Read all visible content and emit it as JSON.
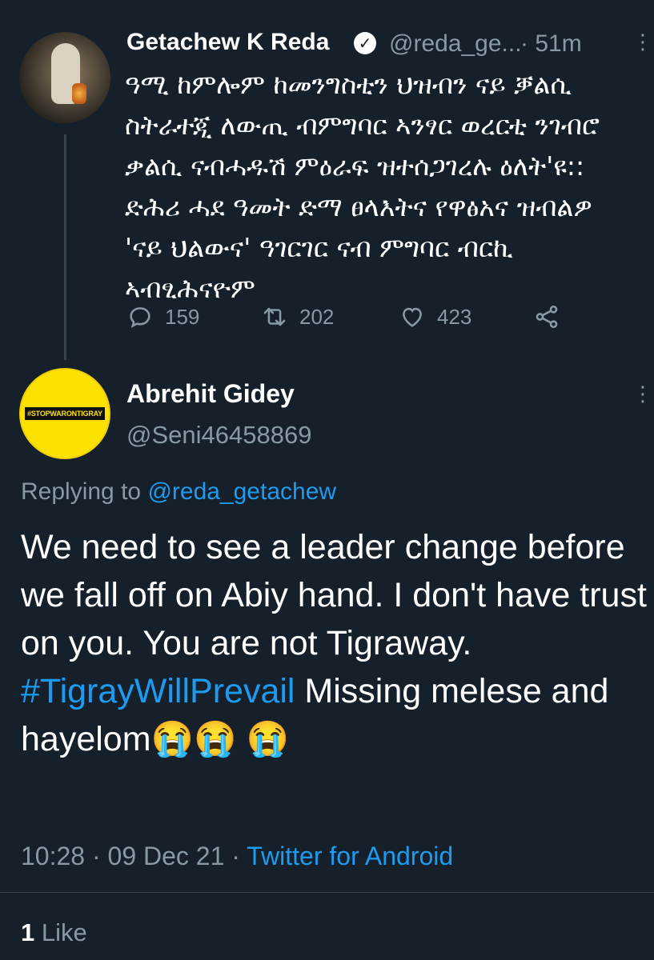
{
  "tweet1": {
    "author_name": "Getachew K Reda",
    "handle": "@reda_ge...",
    "separator": "·",
    "time_ago": "51m",
    "lines": [
      "ዓሚ ከምሎም ከመንግስቲን ህዝብን ናይ ቓልሲ",
      "ስትራተጂ ለውጢ ብምግባር ኣንፃር ወረርቲ ንገብሮ",
      "ቃልሲ ናብሓዱሽ ምዕራፍ ዝተሰጋገረሉ ዕለት'ዩ::",
      "ድሕሪ ሓደ ዓመት ድማ ፀላእትና የዋፅአና ዝብልዎ",
      "'ናይ ህልውና' ዓገርገር ናብ ምግባር ብርኪ",
      "ኣብፂሕናዮም"
    ],
    "replies": "159",
    "retweets": "202",
    "likes": "423"
  },
  "tweet2": {
    "avatar_text": "#STOPWARONTIGRAY",
    "author_name": "Abrehit Gidey",
    "handle": "@Seni46458869",
    "replying_prefix": "Replying to",
    "replying_to": "@reda_getachew",
    "text_before": "We need to see  a leader change before we fall off on Abiy hand. I don't have trust on you. You are not Tigraway. ",
    "hashtag": "#TigrayWillPrevail",
    "text_after": " Missing melese and hayelom😭😭 😭",
    "time": "10:28 · 09 Dec 21 ·",
    "source": "Twitter for Android",
    "like_count": "1",
    "like_label": "Like"
  },
  "colors": {
    "background": "#15202b",
    "muted": "#8899a6",
    "link": "#1d9bf0",
    "divider": "#38444d"
  },
  "icons": [
    "reply-icon",
    "retweet-icon",
    "like-icon",
    "share-icon",
    "more-icon",
    "verified-badge-icon"
  ]
}
